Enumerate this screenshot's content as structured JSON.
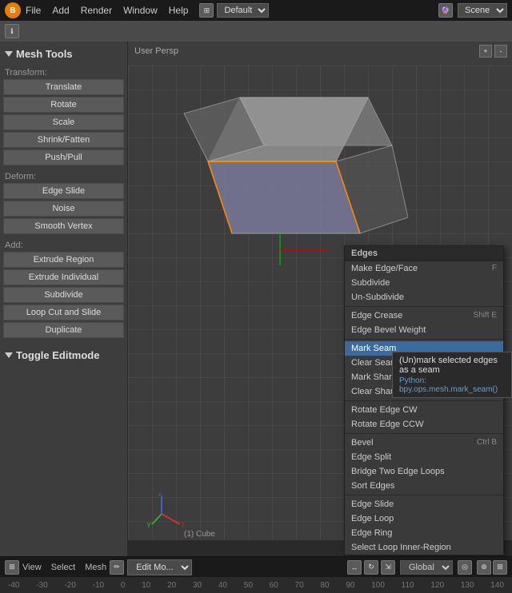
{
  "app": {
    "name": "Blender",
    "logo": "B"
  },
  "topbar": {
    "menus": [
      "File",
      "Add",
      "Render",
      "Window",
      "Help"
    ],
    "layout_icon": "⊞",
    "workspace": "Default",
    "scene_label": "Scene"
  },
  "left_panel": {
    "header": "Mesh Tools",
    "sections": {
      "transform": {
        "label": "Transform:",
        "buttons": [
          "Translate",
          "Rotate",
          "Scale",
          "Shrink/Fatten",
          "Push/Pull"
        ]
      },
      "deform": {
        "label": "Deform:",
        "buttons": [
          "Edge Slide",
          "Noise",
          "Smooth Vertex"
        ]
      },
      "add": {
        "label": "Add:",
        "buttons": [
          "Extrude Region",
          "Extrude Individual",
          "Subdivide",
          "Loop Cut and Slide",
          "Duplicate"
        ]
      },
      "toggle": {
        "label": "Toggle Editmode"
      }
    }
  },
  "viewport": {
    "label": "User Persp",
    "controls": [
      "+",
      "-"
    ],
    "object_info": "(1) Cube"
  },
  "context_menu": {
    "header": "Edges",
    "items": [
      {
        "label": "Make Edge/Face",
        "shortcut": "F",
        "active": false
      },
      {
        "label": "Subdivide",
        "shortcut": "",
        "active": false
      },
      {
        "label": "Un-Subdivide",
        "shortcut": "",
        "active": false
      },
      {
        "separator": true
      },
      {
        "label": "Edge Crease",
        "shortcut": "Shift E",
        "active": false
      },
      {
        "label": "Edge Bevel Weight",
        "shortcut": "",
        "active": false
      },
      {
        "separator": true
      },
      {
        "label": "Mark Seam",
        "shortcut": "",
        "active": true
      },
      {
        "label": "Clear Seam",
        "shortcut": "",
        "active": false
      },
      {
        "label": "Mark Sharp",
        "shortcut": "",
        "active": false
      },
      {
        "label": "Clear Sharp",
        "shortcut": "",
        "active": false
      },
      {
        "separator": true
      },
      {
        "label": "Rotate Edge CW",
        "shortcut": "",
        "active": false
      },
      {
        "label": "Rotate Edge CCW",
        "shortcut": "",
        "active": false
      },
      {
        "separator": true
      },
      {
        "label": "Bevel",
        "shortcut": "Ctrl B",
        "active": false
      },
      {
        "label": "Edge Split",
        "shortcut": "",
        "active": false
      },
      {
        "label": "Bridge Two Edge Loops",
        "shortcut": "",
        "active": false
      },
      {
        "label": "Sort Edges",
        "shortcut": "",
        "active": false
      },
      {
        "separator": true
      },
      {
        "label": "Edge Slide",
        "shortcut": "",
        "active": false
      },
      {
        "label": "Edge Loop",
        "shortcut": "",
        "active": false
      },
      {
        "label": "Edge Ring",
        "shortcut": "",
        "active": false
      },
      {
        "label": "Select Loop Inner-Region",
        "shortcut": "",
        "active": false
      }
    ]
  },
  "tooltip": {
    "text": "(Un)mark selected edges as a seam",
    "python": "Python: bpy.ops.mesh.mark_seam()"
  },
  "bottom_bar": {
    "view": "View",
    "select": "Select",
    "mesh": "Mesh",
    "mode": "Edit Mo...",
    "global": "Global",
    "object_info": "(1) Cube"
  },
  "numbers": [
    "-40",
    "-30",
    "-20",
    "-10",
    "0",
    "10",
    "20",
    "30",
    "40",
    "50",
    "60",
    "70",
    "80",
    "90",
    "100",
    "110",
    "120",
    "130",
    "140"
  ]
}
